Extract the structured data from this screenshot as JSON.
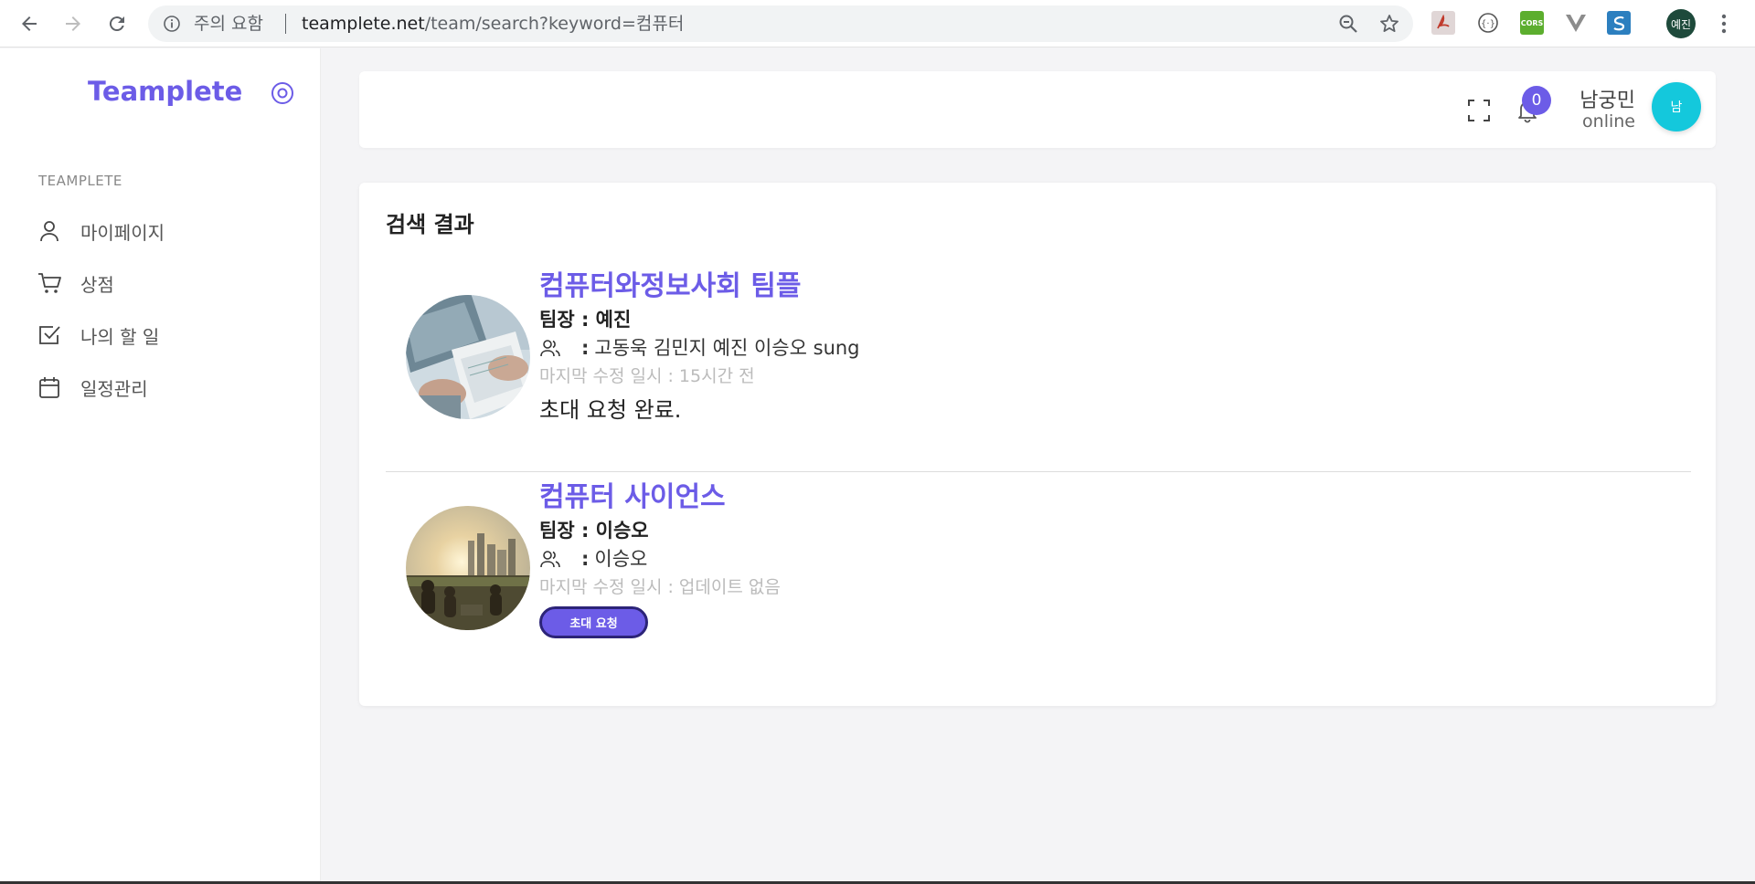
{
  "browser": {
    "security_warning": "주의 요함",
    "url_host": "teamplete.net",
    "url_path": "/team/search?keyword=컴퓨터",
    "profile_label": "예진",
    "extensions": [
      "acrobat-icon",
      "code-braces-icon",
      "cors-icon",
      "vue-devtools-icon",
      "s-extension-icon"
    ],
    "extension_cors_label": "CORS"
  },
  "sidebar": {
    "brand": "Teamplete",
    "section_title": "TEAMPLETE",
    "items": [
      {
        "label": "마이페이지",
        "icon": "user-icon"
      },
      {
        "label": "상점",
        "icon": "cart-icon"
      },
      {
        "label": "나의 할 일",
        "icon": "checkbox-icon"
      },
      {
        "label": "일정관리",
        "icon": "calendar-icon"
      }
    ]
  },
  "header": {
    "notification_count": "0",
    "user_name": "남궁민",
    "user_status": "online",
    "avatar_label": "남"
  },
  "results": {
    "title": "검색 결과",
    "teams": [
      {
        "name": "컴퓨터와정보사회 팀플",
        "leader": "팀장 : 예진",
        "members_colon": ":",
        "members": "고동욱 김민지 예진 이승오 sung",
        "last_modified": "마지막 수정 일시 : 15시간 전",
        "status": "초대 요청 완료."
      },
      {
        "name": "컴퓨터 사이언스",
        "leader": "팀장 : 이승오",
        "members_colon": ":",
        "members": "이승오",
        "last_modified": "마지막 수정 일시 : 업데이트 없음",
        "button": "초대 요청"
      }
    ]
  },
  "colors": {
    "accent": "#6c5ce7",
    "avatar": "#14c8dc",
    "profile": "#1e4a3b"
  }
}
